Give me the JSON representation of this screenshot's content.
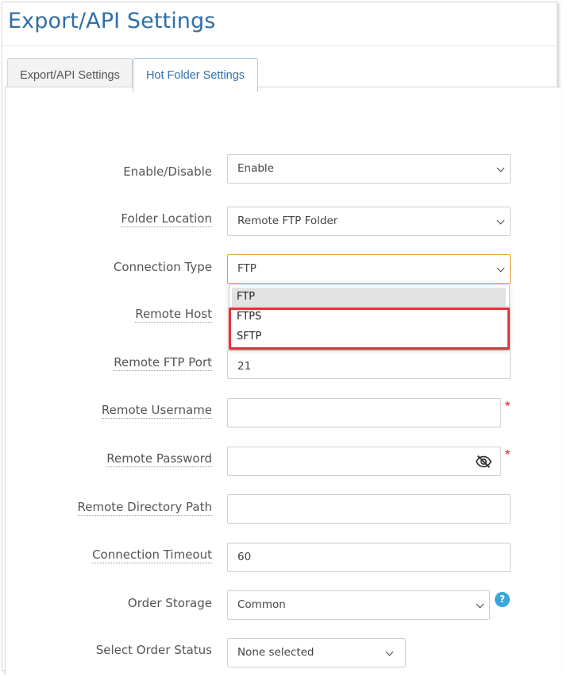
{
  "page": {
    "title": "Export/API Settings"
  },
  "tabs": [
    {
      "label": "Export/API Settings",
      "active": false
    },
    {
      "label": "Hot Folder Settings",
      "active": true
    }
  ],
  "form": {
    "enable_disable": {
      "label": "Enable/Disable",
      "value": "Enable"
    },
    "folder_location": {
      "label": "Folder Location",
      "value": "Remote FTP Folder"
    },
    "connection_type": {
      "label": "Connection Type",
      "value": "FTP",
      "options": [
        "FTP",
        "FTPS",
        "SFTP"
      ]
    },
    "remote_host": {
      "label": "Remote Host",
      "value": ""
    },
    "remote_ftp_port": {
      "label": "Remote FTP Port",
      "value": "21"
    },
    "remote_username": {
      "label": "Remote Username",
      "value": "",
      "required_mark": "*"
    },
    "remote_password": {
      "label": "Remote Password",
      "value": "",
      "required_mark": "*",
      "icon": "eye-slash-icon"
    },
    "remote_directory_path": {
      "label": "Remote Directory Path",
      "value": ""
    },
    "connection_timeout": {
      "label": "Connection Timeout",
      "value": "60"
    },
    "order_storage": {
      "label": "Order Storage",
      "value": "Common",
      "help": "?"
    },
    "select_order_status": {
      "label": "Select Order Status",
      "value": "None selected"
    }
  },
  "colors": {
    "accent": "#2f6fa7",
    "focus": "#e8a23d",
    "highlight": "#e5333b",
    "required": "#d9534f",
    "help": "#39a7da"
  }
}
